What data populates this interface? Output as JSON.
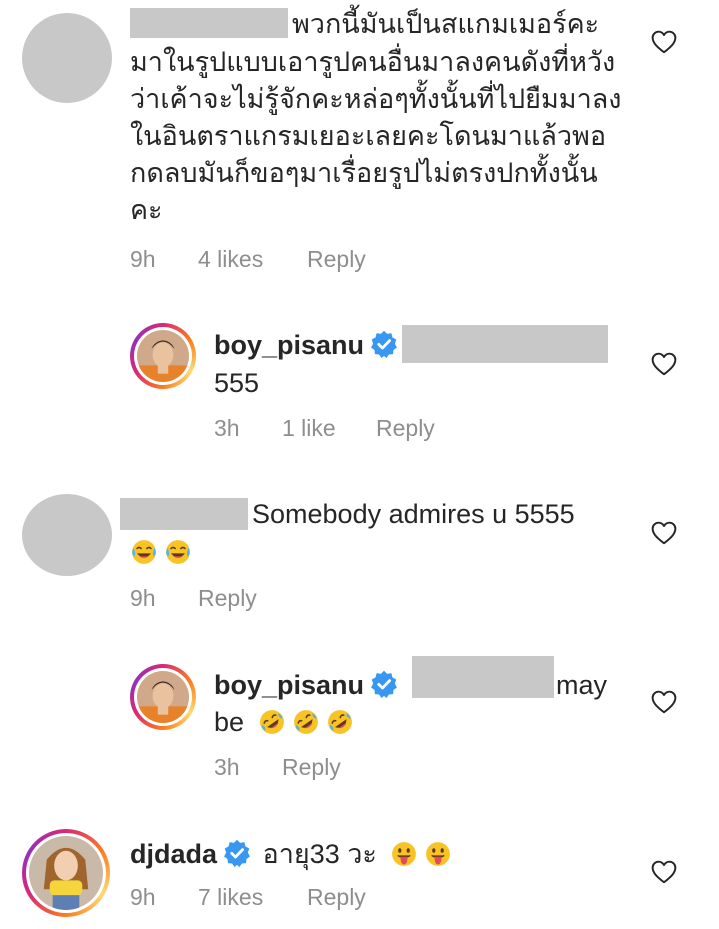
{
  "comments": [
    {
      "avatar": "gray-placeholder",
      "lines": [
        "พวกนี้มันเป็นสแกมเมอร์คะ",
        "มาในรูปแบบเอารูปคนอื่นมาลงคนดังที่หวัง",
        "ว่าเค้าจะไม่รู้จักคะหล่อๆทั้งนั้นที่ไปยืมมาลง",
        "ในอินตราแกรมเยอะเลยคะโดนมาแล้วพอ",
        "กดลบมันก็ขอๆมาเรื่อยรูปไม่ตรงปกทั้งนั้น",
        "คะ"
      ],
      "time": "9h",
      "likes": "4 likes",
      "reply": "Reply"
    },
    {
      "avatar": "profile-photo",
      "username": "boy_pisanu",
      "text": "555",
      "time": "3h",
      "likes": "1 like",
      "reply": "Reply"
    },
    {
      "avatar": "gray-placeholder",
      "text": "Somebody admires u 5555",
      "emojis": [
        "laughing-tears-emoji",
        "laughing-tears-emoji"
      ],
      "time": "9h",
      "reply": "Reply"
    },
    {
      "avatar": "profile-photo",
      "username": "boy_pisanu",
      "text_tail": "may",
      "text_line2": "be",
      "emojis": [
        "rofl-emoji",
        "rofl-emoji",
        "rofl-emoji"
      ],
      "time": "3h",
      "reply": "Reply"
    },
    {
      "avatar": "profile-photo",
      "username": "djdada",
      "text": "อายุ33 วะ",
      "emojis": [
        "tongue-emoji",
        "tongue-emoji"
      ],
      "time": "9h",
      "likes": "7 likes",
      "reply": "Reply"
    }
  ],
  "colors": {
    "text": "#262626",
    "meta": "#8e8e8e",
    "verified": "#3897f0",
    "placeholder": "#c8c8c8"
  },
  "icons": [
    "heart-icon",
    "verified-badge-icon"
  ]
}
